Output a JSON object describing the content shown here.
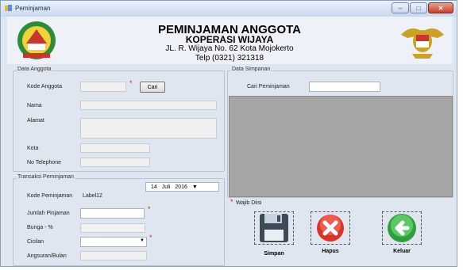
{
  "window": {
    "title": "Peminjaman"
  },
  "header": {
    "title": "PEMINJAMAN ANGGOTA",
    "subtitle": "KOPERASI WIJAYA",
    "address": "JL. R. Wijaya No. 62 Kota Mojokerto",
    "phone": "Telp (0321) 321318"
  },
  "data_anggota": {
    "group_label": "Data Anggota",
    "kode_label": "Kode Anggota",
    "kode_value": "",
    "cari_button": "Cari",
    "nama_label": "Nama",
    "alamat_label": "Alamat",
    "kota_label": "Kota",
    "telp_label": "No Telephone"
  },
  "transaksi": {
    "group_label": "Transaksi Peminjaman",
    "date_day": "14",
    "date_month": "Juli",
    "date_year": "2016",
    "kode_pinjam_label": "Kode Peminjaman",
    "kode_pinjam_value": "Label12",
    "jumlah_label": "Jumlah Pinjaman",
    "bunga_label": "Bunga -  %",
    "cicilan_label": "Cicilan",
    "angsuran_label": "Angsuran/Bulan"
  },
  "data_simpanan": {
    "group_label": "Data Simpanan",
    "cari_label": "Cari Peminjaman",
    "cari_value": ""
  },
  "wajib_note": "Wajib Diisi",
  "actions": {
    "simpan": "Simpan",
    "hapus": "Hapus",
    "keluar": "Keluar"
  },
  "colors": {
    "required": "#e32020",
    "grid_bg": "#a6a6a6",
    "window_bg": "#dfe6f0"
  }
}
